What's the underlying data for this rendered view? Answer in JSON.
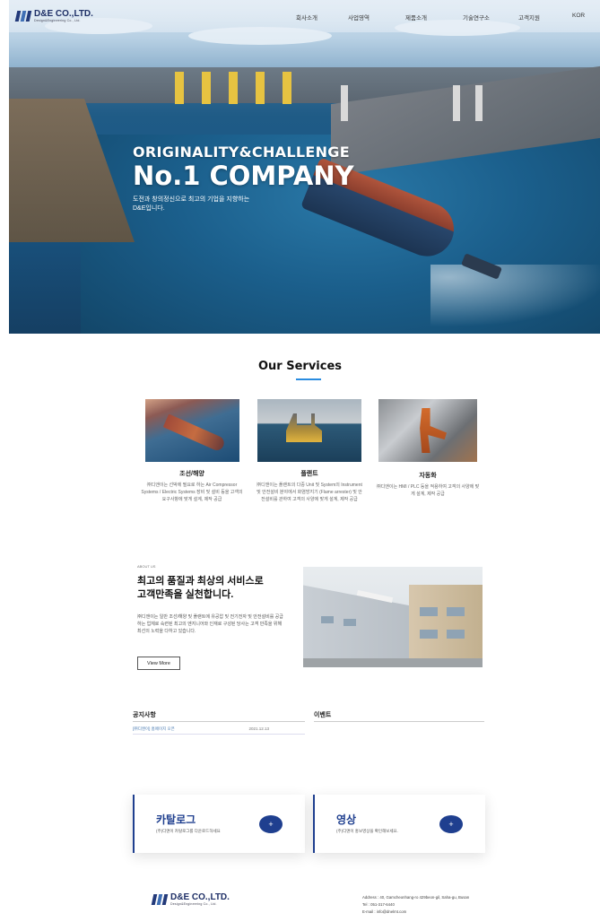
{
  "header": {
    "logo_name": "D&E CO.,LTD.",
    "logo_tagline": "Design&Engineering Co., Ltd.",
    "nav": [
      "회사소개",
      "사업영역",
      "제품소개",
      "기술연구소",
      "고객지원",
      "KOR"
    ]
  },
  "hero": {
    "headline_1": "ORIGINALITY&CHALLENGE",
    "headline_2": "No.1 COMPANY",
    "subtitle_1": "도전과 창의정신으로 최고의 기업을 지향하는",
    "subtitle_2": "D&E입니다."
  },
  "services": {
    "title": "Our Services",
    "items": [
      {
        "title": "조선/해양",
        "desc": "㈜디앤이는 선박에 필요로 하는 Air Compressor Systems / Electric Systems 장비 및 설비 등을 고객의 요구사항에 맞게 설계, 제작 공급"
      },
      {
        "title": "플랜트",
        "desc": "㈜디앤이는 플랜트의 다중 Unit 및 System의 Instrument 및 안전설비 분야에서 화염방지기 (Flame arrester) 및 안전설비를 관하여 고객의 사양에 맞게 설계, 제작 공급"
      },
      {
        "title": "자동화",
        "desc": "㈜디앤이는 HMI / PLC 등을 적용하여 고객의 사양에 맞게 설계, 제작 공급"
      }
    ]
  },
  "about": {
    "small_label": "ABOUT US",
    "title_1": "최고의 품질과 최상의 서비스로",
    "title_2": "고객만족을 실천합니다.",
    "desc": "㈜디앤이는 일반 조선/해양 및 플랜트에 유공압 및 전기전자 및 안전설비를 공급하는 업체로 숙련된 최고의 엔지니어와 인재로 구성된 당사는 고객 만족을 위해 최선의 노력을 다하고 있습니다.",
    "button": "View More"
  },
  "boards": {
    "notice_title": "공지사항",
    "event_title": "이벤트",
    "notices": [
      {
        "title": "[㈜디앤이] 홈페이지 오픈",
        "date": "2021.12.13"
      }
    ]
  },
  "cards": [
    {
      "title": "카탈로그",
      "desc": "(주)디앤이 카탈로그를 다운로드하세요",
      "button": "+"
    },
    {
      "title": "영상",
      "desc": "(주)디앤이 홍보영상을 확인해보세요.",
      "button": "+"
    }
  ],
  "footer": {
    "logo_name": "D&E CO.,LTD.",
    "logo_tagline": "Design&Engineering Co., Ltd.",
    "address": "Address : 40, Gamcheonhang-ro 429beon-gil, Saha-gu, Busan",
    "tel": "Tel : 051-317-6440",
    "email": "E-mail : info@dnelmt.com"
  },
  "colors": {
    "brand": "#1f3f8f",
    "accent": "#2a8ce0"
  }
}
